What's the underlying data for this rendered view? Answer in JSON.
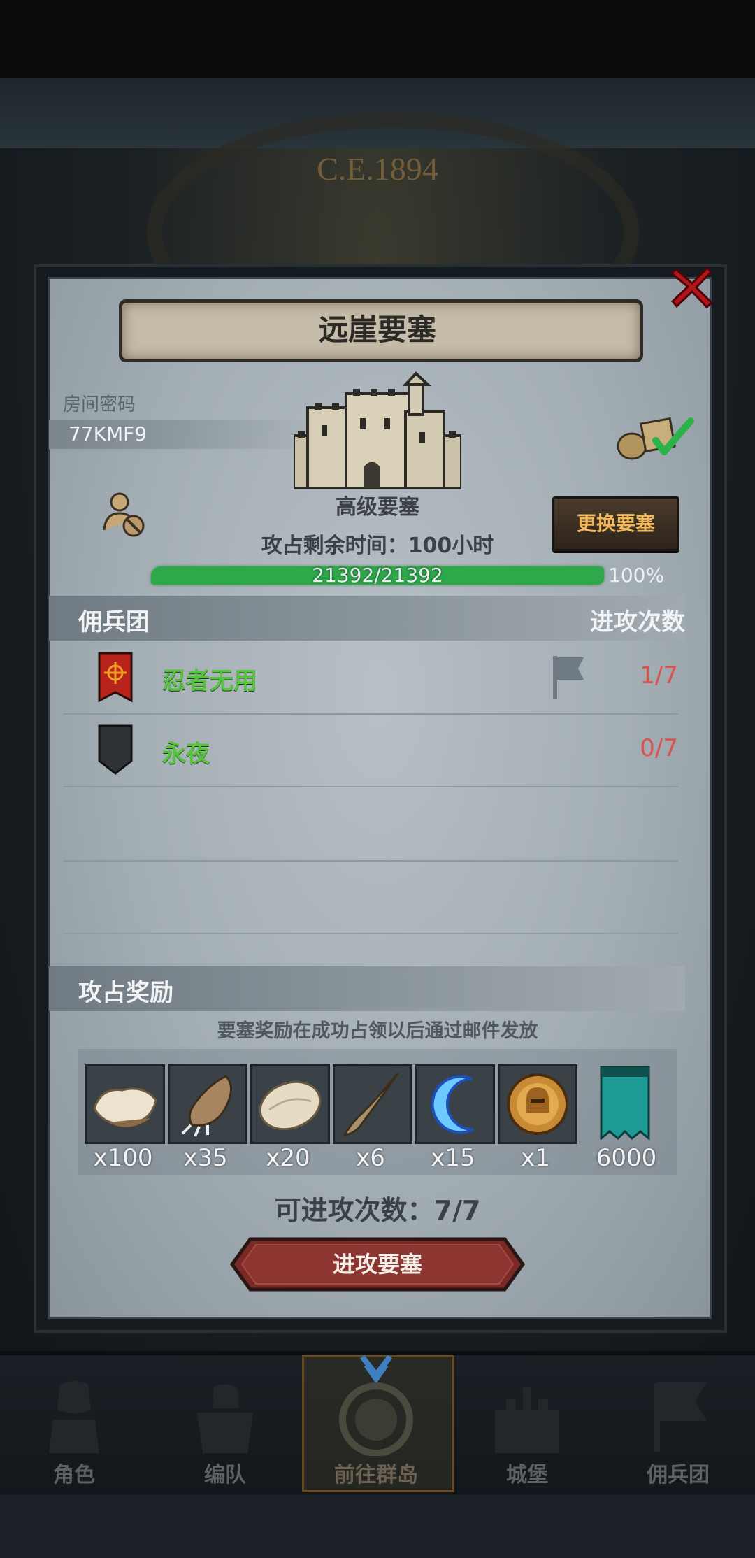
{
  "background": {
    "date_text": "C.E.1894"
  },
  "dialog": {
    "title": "远崖要塞",
    "room_label": "房间密码",
    "room_code": "77KMF9",
    "fortress_type": "高级要塞",
    "change_button": "更换要塞",
    "time_label": "攻占剩余时间：",
    "time_value": "100",
    "time_unit": "小时",
    "hp_text": "21392/21392",
    "hp_percent_text": "100%",
    "hp_fraction": 1.0
  },
  "mercenary": {
    "header_left": "佣兵团",
    "header_right": "进攻次数",
    "rows": [
      {
        "name": "忍者无用",
        "count": "1/7",
        "icon": "red-banner-icon"
      },
      {
        "name": "永夜",
        "count": "0/7",
        "icon": "dark-shield-icon"
      }
    ]
  },
  "rewards": {
    "header": "攻占奖励",
    "note": "要塞奖励在成功占领以后通过邮件发放",
    "items": [
      {
        "qty": "x100",
        "icon": "fur-pelt-icon"
      },
      {
        "qty": "x35",
        "icon": "claw-icon"
      },
      {
        "qty": "x20",
        "icon": "pale-hide-icon"
      },
      {
        "qty": "x6",
        "icon": "horn-icon"
      },
      {
        "qty": "x15",
        "icon": "blue-moon-crescent-icon"
      },
      {
        "qty": "x1",
        "icon": "gold-helmet-medal-icon"
      },
      {
        "qty": "6000",
        "icon": "guild-banner-icon"
      }
    ]
  },
  "attempts": {
    "label": "可进攻次数：",
    "value": "7/7"
  },
  "attack_button": "进攻要塞",
  "nav": {
    "items": [
      {
        "label": "角色"
      },
      {
        "label": "编队"
      },
      {
        "label": "前往群岛"
      },
      {
        "label": "城堡"
      },
      {
        "label": "佣兵团"
      }
    ]
  },
  "colors": {
    "hp_green": "#2ea84a",
    "name_green": "#57c43f",
    "count_red": "#d9534f",
    "accent_gold": "#f0b85a"
  }
}
